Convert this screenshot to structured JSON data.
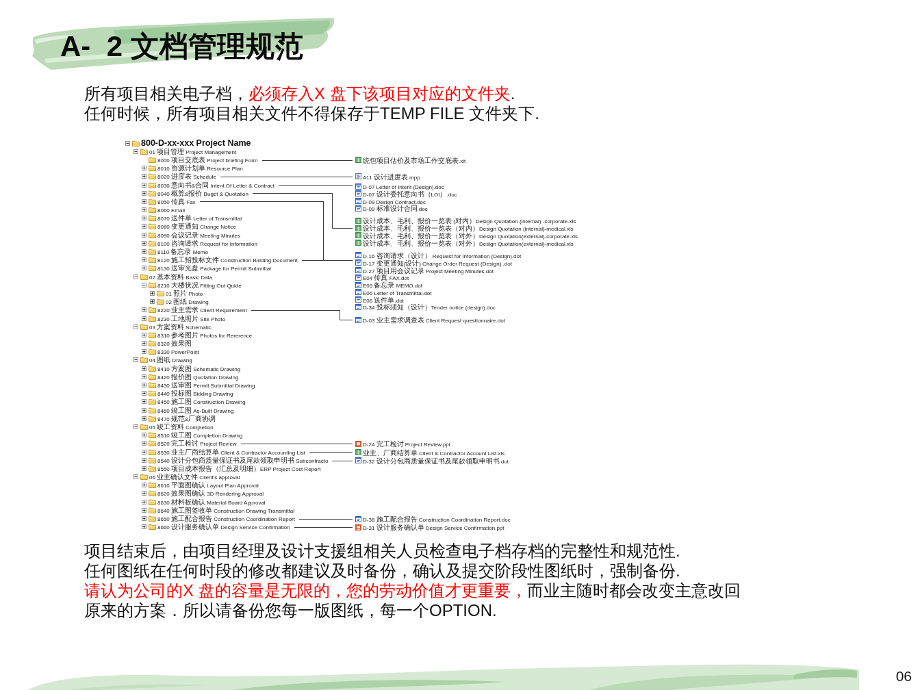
{
  "title": "A-  2 文档管理规范",
  "intro": [
    {
      "segments": [
        {
          "text": "所有项目相关电子档，",
          "emphasis": false
        },
        {
          "text": "必须存入X 盘下该项目对应的文件夹",
          "emphasis": true
        },
        {
          "text": ".",
          "emphasis": false
        }
      ]
    },
    {
      "segments": [
        {
          "text": "任何时候，所有项目相关文件不得保存于TEMP FILE 文件夹下.",
          "emphasis": false
        }
      ]
    }
  ],
  "tree": {
    "label": "800-D-xx-xxx Project Name",
    "expanded": true,
    "children": [
      {
        "label": "01 项目管理 Project Management",
        "expanded": true,
        "children": [
          {
            "label": "8000 项目交底表 Project briefing Form",
            "expandable": false,
            "files": [
              {
                "name": "统包项目估价及市场工作交底表.xlt",
                "kind": "spreadsheet"
              }
            ]
          },
          {
            "label": "8010 资源计划单 Resource Plan",
            "expanded": false
          },
          {
            "label": "8020 进度表 Schedule",
            "expanded": false,
            "files": [
              {
                "name": "A11 设计进度表.mpp",
                "kind": "project"
              }
            ]
          },
          {
            "label": "8030 意向书&合同 Intent Of Letter & Contract",
            "expanded": false,
            "files": [
              {
                "name": "D-07 Letter of Intent (Design).doc",
                "kind": "document"
              },
              {
                "name": "D-07 设计委托意向书（LOI）.doc",
                "kind": "document"
              },
              {
                "name": "D-09 Design Contract.doc",
                "kind": "document"
              },
              {
                "name": "D-09 标准设计合同.doc",
                "kind": "document"
              }
            ]
          },
          {
            "label": "8040 概算&报价 Buget & Quotation",
            "expanded": false,
            "files": [
              {
                "name": "设计成本、毛利、报价一览表 (对内）Design Quotation (internal) -corporate.xls",
                "kind": "spreadsheet"
              },
              {
                "name": "设计成本、毛利、报价一览表（对内）Design Quotation (internal)-medical.xls",
                "kind": "spreadsheet"
              },
              {
                "name": "设计成本、毛利、报价一览表（对外）Design Quotation(external)-corporate.xls",
                "kind": "spreadsheet"
              },
              {
                "name": "设计成本、毛利、报价一览表（对外）Design Quotation(external)-medical.xls",
                "kind": "spreadsheet"
              }
            ]
          },
          {
            "label": "8050 传真 Fax",
            "expanded": false,
            "joins_below": true
          },
          {
            "label": "8060 Email",
            "expanded": false
          },
          {
            "label": "8070 送件单 Letter of Transmittal",
            "expanded": false
          },
          {
            "label": "8080 变更通知 Change Notice",
            "expanded": false
          },
          {
            "label": "8090 会议记录 Meeting Minutes",
            "expanded": false
          },
          {
            "label": "8100 咨询请求 Request for Information",
            "expanded": false
          },
          {
            "label": "8110 备忘录 Memo",
            "expanded": false
          },
          {
            "label": "8120 施工招投标文件 Construction Bidding Document",
            "expanded": false,
            "files": [
              {
                "name": "D-16 咨询请求（设计） Request for Information (Design).dot",
                "kind": "document"
              },
              {
                "name": "D-17 变更通知(设计) Change Order Request (Design) .dot",
                "kind": "document"
              },
              {
                "name": "D-27 项目用会议记录 Project Meeting Minutes.dot",
                "kind": "document"
              },
              {
                "name": "E04 传真 FAX.dot",
                "kind": "document"
              },
              {
                "name": "E05 备忘录 MEMO.dot",
                "kind": "document"
              },
              {
                "name": "E06 Letter of Transmittal.dot",
                "kind": "document"
              },
              {
                "name": "E06 送件单.dot",
                "kind": "document"
              },
              {
                "name": "D-34 投标须知（设计）Tender notice (design).doc",
                "kind": "document"
              }
            ]
          },
          {
            "label": "8130 送审光盘 Package for Permit Submittal",
            "expanded": false
          }
        ]
      },
      {
        "label": "02 基本资料 Basic Data",
        "expanded": true,
        "children": [
          {
            "label": "8210 大楼状况 Fitting Out Quide",
            "expanded": true,
            "children": [
              {
                "label": "01 照片 Photo",
                "expanded": false
              },
              {
                "label": "02 图纸 Drawing",
                "expanded": false
              }
            ]
          },
          {
            "label": "8220 业主需求 Client Requirement",
            "expanded": false,
            "files": [
              {
                "name": "D-03 业主需求调查表 Client Request questionnaire.dot",
                "kind": "document"
              }
            ]
          },
          {
            "label": "8230 工地照片 Site Photo",
            "expanded": false
          }
        ]
      },
      {
        "label": "03 方案资料 Schematic",
        "expanded": true,
        "children": [
          {
            "label": "8310 参考图片 Photos for Rererence",
            "expanded": false
          },
          {
            "label": "8320 效果图",
            "expanded": false
          },
          {
            "label": "8330 PowerPoint",
            "expanded": false
          }
        ]
      },
      {
        "label": "04 图纸 Drawing",
        "expanded": true,
        "children": [
          {
            "label": "8410 方案图 Schematic Drawing",
            "expanded": false
          },
          {
            "label": "8420 报价图 Quotation Drawing",
            "expanded": false
          },
          {
            "label": "8430 送审图 Permit Submittal Drawing",
            "expanded": false
          },
          {
            "label": "8440 投标图 Bidding Drawing",
            "expanded": false
          },
          {
            "label": "8450 施工图 Construction Drawing",
            "expanded": false
          },
          {
            "label": "8460 竣工图 As-Built Drawing",
            "expanded": false
          },
          {
            "label": "8470 规范&厂商协调",
            "expanded": false
          }
        ]
      },
      {
        "label": "05 竣工资料 Completion",
        "expanded": true,
        "children": [
          {
            "label": "8510 竣工图 Completion Drawing",
            "expanded": false
          },
          {
            "label": "8520 完工检讨 Project Review",
            "expanded": false,
            "files": [
              {
                "name": "D-24 完工检讨 Project Review.ppt",
                "kind": "presentation"
              }
            ]
          },
          {
            "label": "8530 业主厂商结算单 Client & Contractor Accounting List",
            "expanded": false,
            "files": [
              {
                "name": "业主、厂商结算单 Client & Contractor Account List.xls",
                "kind": "spreadsheet"
              }
            ]
          },
          {
            "label": "8540 设计分包商质量保证书及尾款领取申明书 Subcontracto",
            "expanded": false,
            "files": [
              {
                "name": "D-32 设计分包商质量保证书及尾款领取申明书.dot",
                "kind": "document"
              }
            ]
          },
          {
            "label": "8550 项目成本报告（汇总及明细）ERP Project Cost Report",
            "expanded": false
          }
        ]
      },
      {
        "label": "06 业主确认文件 Client's approval",
        "expanded": true,
        "children": [
          {
            "label": "8610 平面图确认 Layout Plan Approval",
            "expanded": false
          },
          {
            "label": "8620 效果图确认 3D Rendering Approval",
            "expanded": false
          },
          {
            "label": "8630 材料板确认 Material Board Approval",
            "expanded": false
          },
          {
            "label": "8640 施工图签收单 Construction Drawing Transmittal",
            "expanded": false
          },
          {
            "label": "8650 施工配合报告 Construction Coordination Report",
            "expanded": false,
            "files": [
              {
                "name": "D-38 施工配合报告 Construction Coordination Report.doc",
                "kind": "document"
              }
            ]
          },
          {
            "label": "8660 设计服务确认单 Design Service Confirmation",
            "expanded": false,
            "files": [
              {
                "name": "D-31 设计服务确认单 Design Service Confirmation.ppt",
                "kind": "presentation"
              }
            ]
          }
        ]
      }
    ]
  },
  "notes": [
    {
      "segments": [
        {
          "text": "项目结束后，由项目经理及设计支援组相关人员检查电子档存档的完整性和规范性.",
          "emphasis": false
        }
      ]
    },
    {
      "segments": [
        {
          "text": "任何图纸在任何时段的修改都建议及时备份，确认及提交阶段性图纸时，强制备份.",
          "emphasis": false
        }
      ]
    },
    {
      "segments": [
        {
          "text": "请认为公司的X 盘的容量是无限的，您的劳动价值才更重要，",
          "emphasis": true
        },
        {
          "text": "而业主随时都会改变主意改回原来的方案．所以请备份您每一版图纸，每一个OPTION.",
          "emphasis": false
        }
      ]
    }
  ],
  "page_number": "06"
}
